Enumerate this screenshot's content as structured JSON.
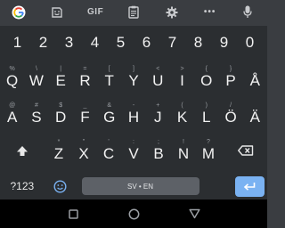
{
  "toolbar": {
    "gif_label": "GIF",
    "more_label": "•••"
  },
  "keyboard": {
    "number_row": [
      "1",
      "2",
      "3",
      "4",
      "5",
      "6",
      "7",
      "8",
      "9",
      "0"
    ],
    "row1": [
      {
        "hint": "%",
        "key": "Q"
      },
      {
        "hint": "\\",
        "key": "W"
      },
      {
        "hint": "|",
        "key": "E"
      },
      {
        "hint": "=",
        "key": "R"
      },
      {
        "hint": "[",
        "key": "T"
      },
      {
        "hint": "]",
        "key": "Y"
      },
      {
        "hint": "<",
        "key": "U"
      },
      {
        "hint": ">",
        "key": "I"
      },
      {
        "hint": "{",
        "key": "O"
      },
      {
        "hint": "}",
        "key": "P"
      },
      {
        "hint": "",
        "key": "Å"
      }
    ],
    "row2": [
      {
        "hint": "@",
        "key": "A"
      },
      {
        "hint": "#",
        "key": "S"
      },
      {
        "hint": "$",
        "key": "D"
      },
      {
        "hint": "_",
        "key": "F"
      },
      {
        "hint": "&",
        "key": "G"
      },
      {
        "hint": "-",
        "key": "H"
      },
      {
        "hint": "+",
        "key": "J"
      },
      {
        "hint": "(",
        "key": "K"
      },
      {
        "hint": ")",
        "key": "L"
      },
      {
        "hint": "/",
        "key": "Ö"
      },
      {
        "hint": "",
        "key": "Ä"
      }
    ],
    "row3": [
      {
        "hint": "*",
        "key": "Z"
      },
      {
        "hint": "\"",
        "key": "X"
      },
      {
        "hint": "'",
        "key": "C"
      },
      {
        "hint": ":",
        "key": "V"
      },
      {
        "hint": ";",
        "key": "B"
      },
      {
        "hint": "!",
        "key": "N"
      },
      {
        "hint": "?",
        "key": "M"
      }
    ],
    "symbols_label": "?123",
    "space_label": "SV • EN"
  },
  "colors": {
    "accent": "#7ab2f2",
    "keyboard_bg": "#2b2e31",
    "toolbar_bg": "#3a3d41"
  }
}
